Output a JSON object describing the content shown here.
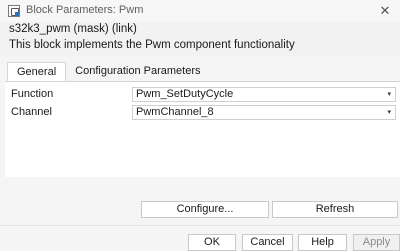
{
  "window": {
    "title": "Block Parameters: Pwm",
    "close_glyph": "✕"
  },
  "header": {
    "mask_title": "s32k3_pwm (mask) (link)",
    "description": "This block implements the Pwm component functionality"
  },
  "tabs": [
    {
      "label": "General",
      "active": true
    },
    {
      "label": "Configuration Parameters",
      "active": false
    }
  ],
  "params": {
    "function": {
      "label": "Function",
      "value": "Pwm_SetDutyCycle"
    },
    "channel": {
      "label": "Channel",
      "value": "PwmChannel_8"
    }
  },
  "actions": {
    "configure": "Configure...",
    "refresh": "Refresh"
  },
  "footer": {
    "ok": "OK",
    "cancel": "Cancel",
    "help": "Help",
    "apply": "Apply"
  },
  "icons": {
    "dropdown": "▾"
  }
}
